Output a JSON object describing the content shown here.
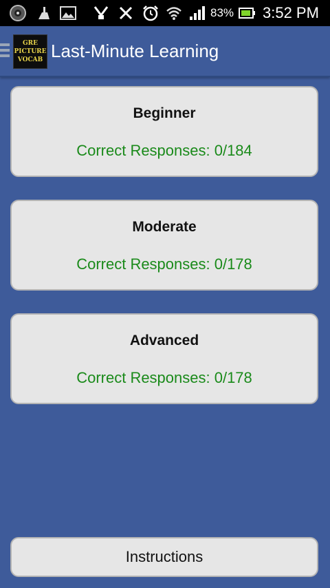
{
  "status_bar": {
    "battery_percent": "83%",
    "time": "3:52 PM",
    "icons": [
      "app-notification-icon",
      "cleaner-icon",
      "image-icon",
      "usb-debug-icon",
      "tools-icon",
      "alarm-icon",
      "wifi-icon",
      "signal-icon",
      "battery-icon"
    ]
  },
  "action_bar": {
    "logo_text": [
      "GRE",
      "PICTURE",
      "VOCAB"
    ],
    "title": "Last-Minute Learning"
  },
  "levels": [
    {
      "name": "Beginner",
      "score": "Correct Responses: 0/184"
    },
    {
      "name": "Moderate",
      "score": "Correct Responses: 0/178"
    },
    {
      "name": "Advanced",
      "score": "Correct Responses: 0/178"
    }
  ],
  "instructions_label": "Instructions",
  "colors": {
    "background": "#3e5b9a",
    "card": "#e6e6e6",
    "score_text": "#1a8a1a"
  }
}
